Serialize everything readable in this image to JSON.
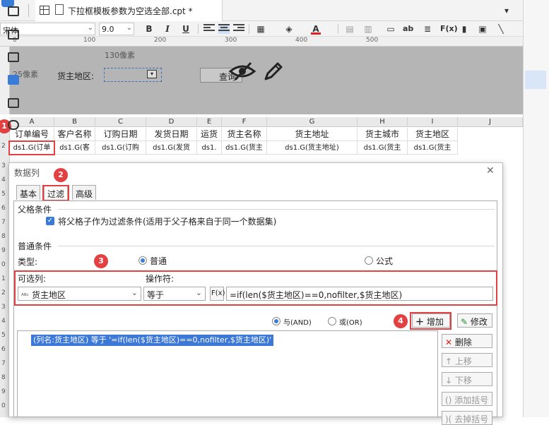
{
  "tab": {
    "title": "下拉框模板参数为空选全部.cpt *"
  },
  "toolbar": {
    "font": "宋体",
    "size": "9.0",
    "bold": "B",
    "italic": "I",
    "underline": "U",
    "text_ab": "ab",
    "fx": "F(x)"
  },
  "ruler": [
    "0",
    "100",
    "200",
    "300",
    "400",
    "500"
  ],
  "param_panel": {
    "width_label": "130像素",
    "height_label": "25像素",
    "param_label": "货主地区:",
    "query_button": "查询"
  },
  "grid": {
    "columns": [
      "A",
      "B",
      "C",
      "D",
      "E",
      "F",
      "G",
      "H",
      "I",
      "J"
    ],
    "headers": [
      "订单编号",
      "客户名称",
      "订购日期",
      "发货日期",
      "运货",
      "货主名称",
      "货主地址",
      "货主城市",
      "货主地区"
    ],
    "cells": [
      "ds1.G(订单",
      "ds1.G(客",
      "ds1.G(订购",
      "ds1.G(发货",
      "ds1.",
      "ds1.G(货主",
      "ds1.G(货主地址)",
      "ds1.G(货主",
      "ds1.G(货主"
    ],
    "row_numbers": [
      "0",
      "1",
      "2",
      "3",
      "4",
      "5",
      "6",
      "7",
      "8",
      "9",
      "0",
      "1",
      "2",
      "3",
      "4",
      "5",
      "6",
      "7",
      "8",
      "9",
      "0",
      "1"
    ]
  },
  "markers": [
    "1",
    "2",
    "3",
    "4"
  ],
  "dialog": {
    "title": "数据列",
    "tabs": [
      "基本",
      "过滤",
      "高级"
    ],
    "parent_group": "父格条件",
    "parent_checkbox": "将父格子作为过滤条件(适用于父子格来自于同一个数据集)",
    "common_group": "普通条件",
    "type_label": "类型:",
    "type_common": "普通",
    "type_formula": "公式",
    "col_label": "可选列:",
    "op_label": "操作符:",
    "col_value": "货主地区",
    "op_value": "等于",
    "fx": "F(x)",
    "formula": "=if(len($货主地区)==0,nofilter,$货主地区)",
    "and_label": "与(AND)",
    "or_label": "或(OR)",
    "add_button": "增加",
    "edit_button": "修改",
    "delete_button": "删除",
    "up_button": "上移",
    "down_button": "下移",
    "paren_button": "添加括号",
    "remove_paren_button": "去掉括号",
    "condition": "(列名:货主地区) 等于 '=if(len($货主地区)==0,nofilter,$货主地区)'"
  }
}
